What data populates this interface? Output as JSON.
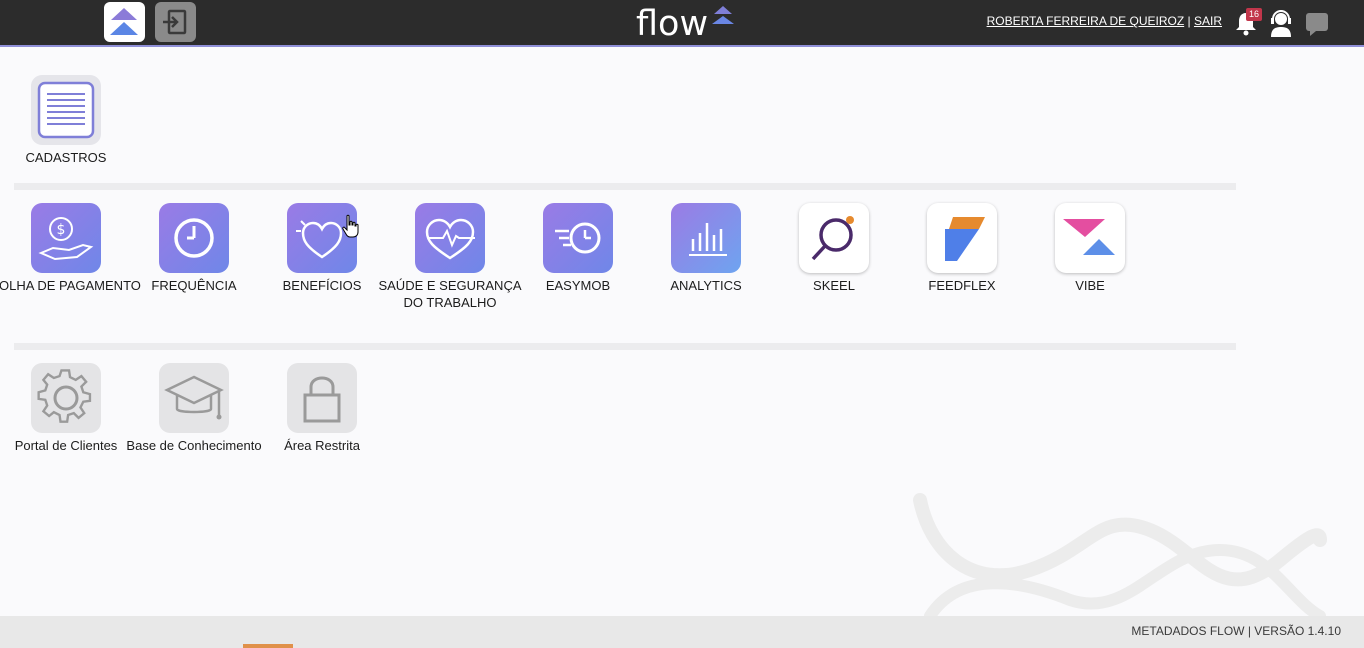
{
  "header": {
    "user_name": "ROBERTA FERREIRA DE QUEIROZ",
    "separator": "|",
    "logout_label": "SAIR",
    "notification_count": "16",
    "logo_text": "flow",
    "home_icon": "flow-logo-icon",
    "exit_icon": "sign-in-icon"
  },
  "sections": {
    "cadastros": {
      "label": "CADASTROS"
    },
    "apps": [
      {
        "label": "FOLHA DE PAGAMENTO",
        "icon": "hand-coin-icon"
      },
      {
        "label": "FREQUÊNCIA",
        "icon": "clock-icon"
      },
      {
        "label": "BENEFÍCIOS",
        "icon": "heart-icon"
      },
      {
        "label": "SAÚDE E SEGURANÇA DO TRABALHO",
        "icon": "heartbeat-icon"
      },
      {
        "label": "EASYMOB",
        "icon": "fast-clock-icon"
      },
      {
        "label": "ANALYTICS",
        "icon": "bar-chart-icon"
      },
      {
        "label": "SKEEL",
        "icon": "skeel-logo-icon"
      },
      {
        "label": "FEEDFLEX",
        "icon": "feedflex-logo-icon"
      },
      {
        "label": "VIBE",
        "icon": "vibe-logo-icon"
      }
    ],
    "tools": [
      {
        "label": "Portal de Clientes",
        "icon": "gear-icon"
      },
      {
        "label": "Base de Conhecimento",
        "icon": "graduation-cap-icon"
      },
      {
        "label": "Área Restrita",
        "icon": "lock-icon"
      }
    ]
  },
  "footer": {
    "text": "METADADOS FLOW | VERSÃO 1.4.10"
  },
  "colors": {
    "topbar": "#2c2c2c",
    "accent": "#8f8fd8",
    "tile_gradient_start": "#9a7be6",
    "tile_gradient_end": "#6f87e8",
    "badge": "#c2364b"
  }
}
